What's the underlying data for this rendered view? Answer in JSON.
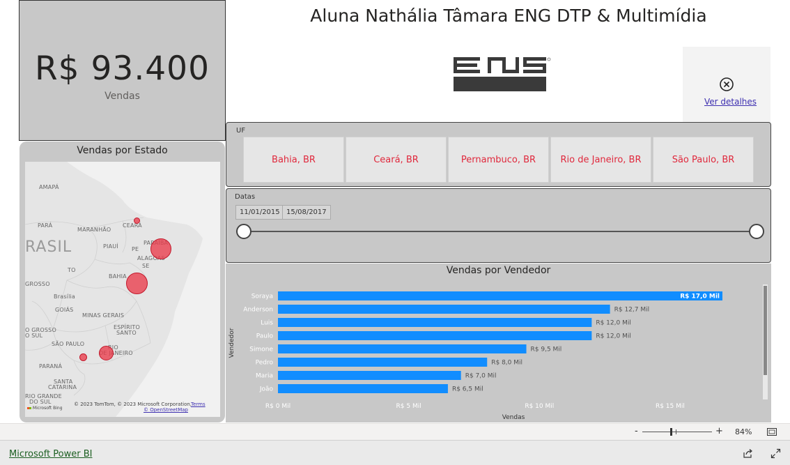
{
  "report": {
    "title": "Aluna Nathália Tâmara ENG DTP & Multimídia"
  },
  "kpi": {
    "value": "R$ 93.400",
    "label": "Vendas"
  },
  "logo": {
    "name": "eng-logo",
    "color": "#3a3a3a"
  },
  "details": {
    "icon": "close-circle-icon",
    "link_label": "Ver detalhes"
  },
  "uf_slicer": {
    "title": "UF",
    "items": [
      {
        "label": "Bahia, BR"
      },
      {
        "label": "Ceará, BR"
      },
      {
        "label": "Pernambuco, BR"
      },
      {
        "label": "Rio de Janeiro, BR"
      },
      {
        "label": "São Paulo, BR"
      }
    ],
    "item_color": "#e0283c"
  },
  "date_slicer": {
    "title": "Datas",
    "start": "11/01/2015",
    "end": "15/08/2017"
  },
  "map": {
    "title": "Vendas por Estado",
    "labels": [
      "AMAPÁ",
      "PARÁ",
      "MARANHÃO",
      "CEARÁ",
      "RASIL",
      "PIAUÍ",
      "PARAÍBA",
      "PE",
      "ALAGOAS",
      "SE",
      "TO",
      "BAHIA",
      "GROSSO",
      "Brasília",
      "GOIÁS",
      "MINAS GERAIS",
      "ESPÍRITO",
      "SANTO",
      "O GROSSO",
      "O SUL",
      "SÃO PAULO",
      "RIO",
      "DE JANEIRO",
      "PARANÁ",
      "SANTA",
      "CATARINA",
      "RIO GRANDE",
      "DO SUL"
    ],
    "credit": "© 2023 TomTom, © 2023 Microsoft Corporation,",
    "terms": "Terms",
    "osm": "© OpenStreetMap",
    "bing": "Microsoft Bing",
    "bubble_color": "#eb3c4b"
  },
  "chart_data": {
    "type": "bar",
    "orientation": "horizontal",
    "title": "Vendas por Vendedor",
    "ylabel": "Vendedor",
    "xlabel": "Vendas",
    "categories": [
      "Soraya",
      "Anderson",
      "Luis",
      "Paulo",
      "Simone",
      "Pedro",
      "Maria",
      "João"
    ],
    "values": [
      17.0,
      12.7,
      12.0,
      12.0,
      9.5,
      8.0,
      7.0,
      6.5
    ],
    "data_labels": [
      "R$ 17,0 Mil",
      "R$ 12,7 Mil",
      "R$ 12,0 Mil",
      "R$ 12,0 Mil",
      "R$ 9,5 Mil",
      "R$ 8,0 Mil",
      "R$ 7,0 Mil",
      "R$ 6,5 Mil"
    ],
    "x_ticks": [
      0,
      5,
      10,
      15
    ],
    "x_tick_labels": [
      "R$ 0 Mil",
      "R$ 5 Mil",
      "R$ 10 Mil",
      "R$ 15 Mil"
    ],
    "xlim": [
      0,
      17.0
    ],
    "bar_color": "#118dff",
    "grid": false
  },
  "statusbar": {
    "zoom_minus": "-",
    "zoom_plus": "+",
    "zoom_level": "84%"
  },
  "footer": {
    "brand": "Microsoft Power BI"
  }
}
